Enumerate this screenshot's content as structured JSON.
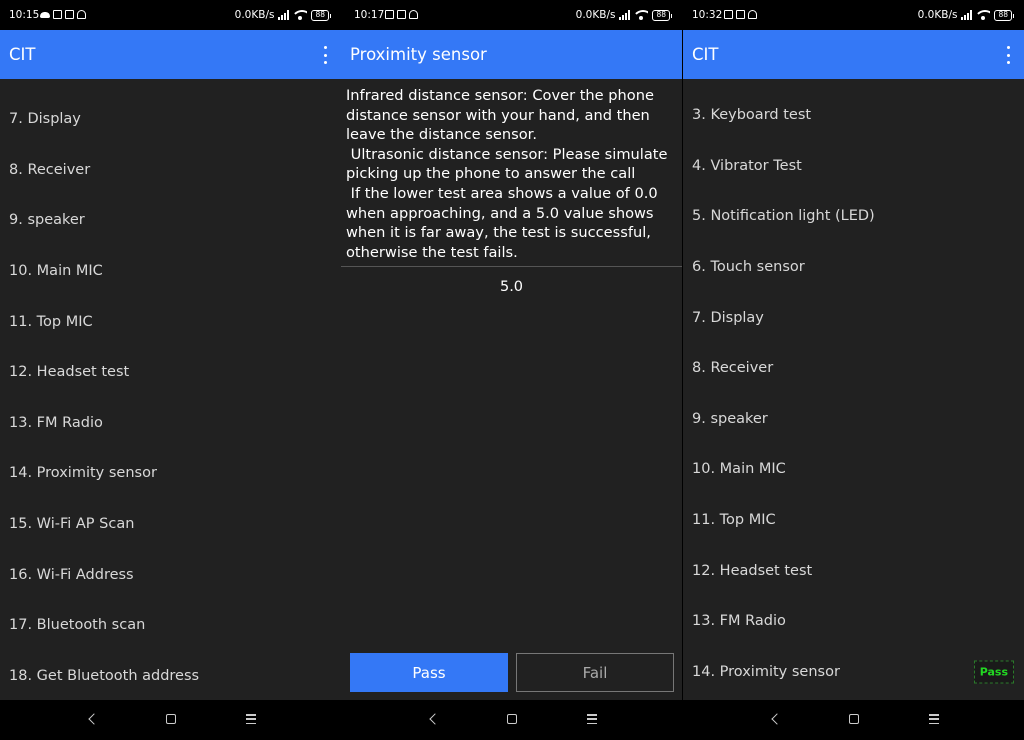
{
  "left_panel": {
    "status": {
      "time": "10:15",
      "network": "0.0KB/s",
      "battery": "88"
    },
    "title": "CIT",
    "items": [
      "7. Display",
      "8. Receiver",
      "9. speaker",
      "10. Main MIC",
      "11. Top MIC",
      "12. Headset test",
      "13. FM Radio",
      "14. Proximity sensor",
      "15. Wi-Fi AP Scan",
      "16. Wi-Fi Address",
      "17. Bluetooth scan",
      "18. Get Bluetooth address"
    ]
  },
  "middle_panel": {
    "status": {
      "time": "10:17",
      "network": "0.0KB/s",
      "battery": "88"
    },
    "title": "Proximity sensor",
    "instructions": "Infrared distance sensor: Cover the phone distance sensor with your hand, and then leave the distance sensor.\n Ultrasonic distance sensor: Please simulate picking up the phone to answer the call\n If the lower test area shows a value of 0.0 when approaching, and a 5.0 value shows when it is far away, the test is successful, otherwise the test fails.",
    "value": "5.0",
    "pass_label": "Pass",
    "fail_label": "Fail"
  },
  "right_panel": {
    "status": {
      "time": "10:32",
      "network": "0.0KB/s",
      "battery": "88"
    },
    "title": "CIT",
    "items": [
      "3. Keyboard test",
      "4. Vibrator Test",
      "5. Notification light (LED)",
      "6. Touch sensor",
      "7. Display",
      "8. Receiver",
      "9. speaker",
      "10. Main MIC",
      "11. Top MIC",
      "12. Headset test",
      "13. FM Radio",
      "14. Proximity sensor"
    ],
    "pass_badge": "Pass",
    "pass_badge_color": "#22d822"
  },
  "theme": {
    "accent": "#3478f6",
    "background": "#212121"
  }
}
